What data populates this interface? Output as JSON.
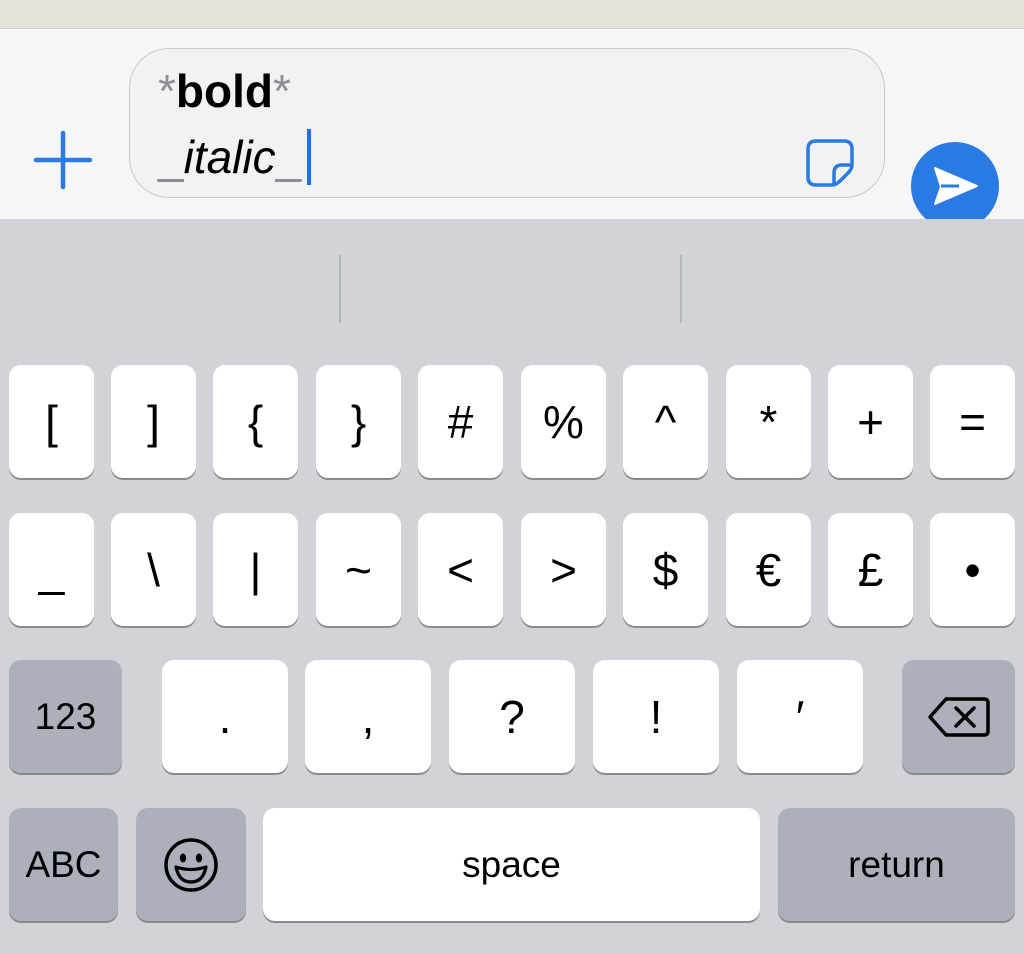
{
  "composer": {
    "line1": {
      "open": "*",
      "text": "bold",
      "close": "*"
    },
    "line2": {
      "open": "_",
      "text": "italic",
      "close": "_"
    },
    "icons": {
      "attach": "plus-icon",
      "sticker": "sticker-icon",
      "send": "send-icon"
    },
    "accent_color": "#2a7ae4"
  },
  "keyboard": {
    "row1": [
      "[",
      "]",
      "{",
      "}",
      "#",
      "%",
      "^",
      "*",
      "+",
      "="
    ],
    "row2": [
      "_",
      "\\",
      "|",
      "~",
      "<",
      ">",
      "$",
      "€",
      "£",
      "•"
    ],
    "row3": {
      "mode": "123",
      "keys": [
        ".",
        ",",
        "?",
        "!",
        "′"
      ],
      "delete_icon": "backspace-icon"
    },
    "row4": {
      "abc": "ABC",
      "emoji_icon": "emoji-icon",
      "space": "space",
      "return": "return"
    }
  }
}
